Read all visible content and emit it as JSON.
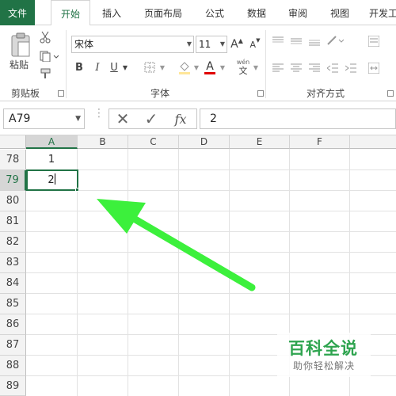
{
  "tabs": [
    "文件",
    "开始",
    "插入",
    "页面布局",
    "公式",
    "数据",
    "审阅",
    "视图",
    "开发工"
  ],
  "clipboard": {
    "paste_label": "粘贴",
    "group_label": "剪贴板"
  },
  "font": {
    "name": "宋体",
    "size": "11",
    "group_label": "字体",
    "bold": "B",
    "italic": "I",
    "underline": "U",
    "grow": "A",
    "shrink": "A",
    "font_color_glyph": "A",
    "wen": "wén",
    "wen_char": "文"
  },
  "alignment": {
    "group_label": "对齐方式"
  },
  "formula_bar": {
    "name_box": "A79",
    "value": "2",
    "cancel_glyph": "✕",
    "enter_glyph": "✓",
    "fx": "fx"
  },
  "columns": [
    "A",
    "B",
    "C",
    "D",
    "E",
    "F"
  ],
  "rows": [
    "78",
    "79",
    "80",
    "81",
    "82",
    "83",
    "84",
    "85",
    "86",
    "87",
    "88",
    "89"
  ],
  "cells": {
    "A78": "1",
    "A79": "2"
  },
  "selected_cell": "A79",
  "watermark": {
    "title": "百科全说",
    "subtitle": "助你轻松解决"
  },
  "colors": {
    "accent": "#217346",
    "arrow": "#3cf03c"
  }
}
